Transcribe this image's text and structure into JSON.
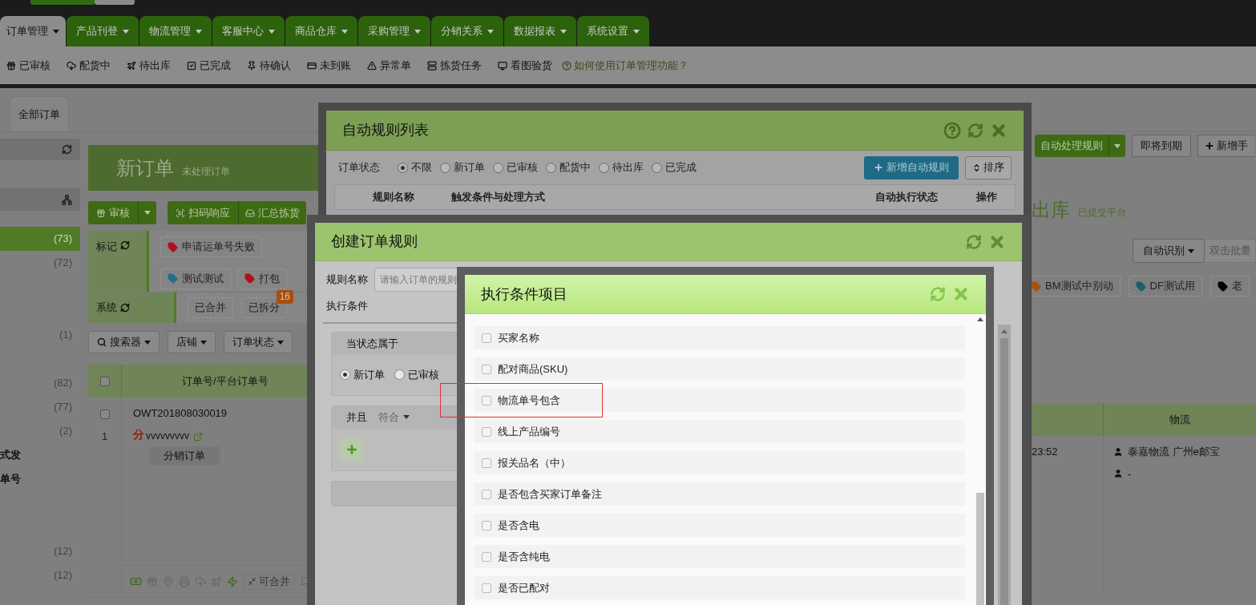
{
  "top_nav": {
    "tabs": [
      {
        "label": "订单管理",
        "selected": true
      },
      {
        "label": "产品刊登",
        "selected": false
      },
      {
        "label": "物流管理",
        "selected": false
      },
      {
        "label": "客服中心",
        "selected": false
      },
      {
        "label": "商品仓库",
        "selected": false
      },
      {
        "label": "采购管理",
        "selected": false
      },
      {
        "label": "分销关系",
        "selected": false
      },
      {
        "label": "数据报表",
        "selected": false
      },
      {
        "label": "系统设置",
        "selected": false
      }
    ]
  },
  "sub_nav": {
    "items": [
      "已审核",
      "配货中",
      "待出库",
      "已完成",
      "待确认",
      "未到账",
      "异常单",
      "拣货任务",
      "看图验货"
    ],
    "help_link": "如何使用订单管理功能？"
  },
  "top_switch": {
    "segments": [
      {
        "selected": true
      },
      {
        "selected": false
      }
    ]
  },
  "page_tab": {
    "label": "全部订单",
    "selected": true
  },
  "sidebar": {
    "groups": [
      {
        "items": [
          {
            "kind": "count",
            "label": "(73)",
            "selected": true
          },
          {
            "kind": "count",
            "label": "(72)",
            "selected": false
          }
        ]
      },
      {
        "items": [
          {
            "kind": "count",
            "label": "(1)",
            "selected": false
          }
        ]
      },
      {
        "items": [
          {
            "kind": "count",
            "label": "(82)",
            "selected": false
          },
          {
            "kind": "count",
            "label": "(77)",
            "selected": false
          },
          {
            "kind": "count",
            "label": "(2)",
            "selected": false
          },
          {
            "kind": "label",
            "label": "式发",
            "selected": false
          },
          {
            "kind": "label",
            "label": "单号",
            "selected": false
          }
        ]
      },
      {
        "items": [
          {
            "kind": "count",
            "label": "(12)",
            "selected": false
          },
          {
            "kind": "count",
            "label": "(12)",
            "selected": false
          }
        ]
      }
    ]
  },
  "left_panel": {
    "title": "新订单",
    "subtitle": "未处理订单",
    "actions": [
      "审核",
      "扫码响应",
      "汇总拣货"
    ],
    "mark_label": "标记",
    "mark_tags": [
      {
        "label": "申请运单号失败",
        "color": "#b0101a"
      },
      {
        "label": "测试测试",
        "color": "#1f6e8c"
      },
      {
        "label": "打包",
        "color": "#b0101a"
      }
    ],
    "system_label": "系统",
    "system_tags": [
      {
        "label": "已合并"
      },
      {
        "label": "已拆分",
        "badge": "16"
      }
    ],
    "search_buttons": [
      "搜索器",
      "店铺",
      "订单状态"
    ],
    "column": "订单号/平台订单号",
    "header_checked": false,
    "rows": [
      {
        "checked": false,
        "index": "1",
        "order_no": "OWT201808030019",
        "tag": "分",
        "buyer": "vvvvvvvvv",
        "type_badge": "分销订单",
        "merge_button": "可合并"
      }
    ]
  },
  "right_panel": {
    "toolbar": [
      "自动处理规则",
      "即将到期",
      "新增手"
    ],
    "title": "出库",
    "subtitle": "已提交平台",
    "recognize_button": "自动识别",
    "batch_placeholder": "双击批量",
    "tags": [
      {
        "label": "BM测试中别动",
        "color": "#a8520c"
      },
      {
        "label": "DF测试用",
        "color": "#17606b"
      },
      {
        "label": "老",
        "color": "#000000"
      }
    ],
    "column": "物流",
    "time": "23:52",
    "logistics": [
      "泰嘉物流 广州e邮宝",
      "-"
    ]
  },
  "rule_list_dialog": {
    "title": "自动规则列表",
    "status_label": "订单状态",
    "statuses": [
      {
        "label": "不限",
        "selected": true
      },
      {
        "label": "新订单",
        "selected": false
      },
      {
        "label": "已审核",
        "selected": false
      },
      {
        "label": "配货中",
        "selected": false
      },
      {
        "label": "待出库",
        "selected": false
      },
      {
        "label": "已完成",
        "selected": false
      }
    ],
    "add_button": "新增自动规则",
    "sort_button": "排序",
    "columns": [
      "规则名称",
      "触发条件与处理方式",
      "自动执行状态",
      "操作"
    ]
  },
  "create_rule_dialog": {
    "title": "创建订单规则",
    "name_label": "规则名称",
    "name_placeholder": "请输入订单的规则",
    "condition_label": "执行条件",
    "state_label": "当状态属于",
    "states": [
      {
        "label": "新订单",
        "selected": true
      },
      {
        "label": "已审核",
        "selected": false
      }
    ],
    "join_label": "并且",
    "match_label": "符合"
  },
  "condition_items_dialog": {
    "title": "执行条件项目",
    "items": [
      {
        "label": "买家名称",
        "checked": false,
        "highlighted": false
      },
      {
        "label": "配对商品(SKU)",
        "checked": false,
        "highlighted": false
      },
      {
        "label": "物流单号包含",
        "checked": false,
        "highlighted": true
      },
      {
        "label": "线上产品编号",
        "checked": false,
        "highlighted": false
      },
      {
        "label": "报关品名（中）",
        "checked": false,
        "highlighted": false
      },
      {
        "label": "是否包含买家订单备注",
        "checked": false,
        "highlighted": false
      },
      {
        "label": "是否含电",
        "checked": false,
        "highlighted": false
      },
      {
        "label": "是否含纯电",
        "checked": false,
        "highlighted": false
      },
      {
        "label": "是否已配对",
        "checked": false,
        "highlighted": false
      }
    ]
  }
}
